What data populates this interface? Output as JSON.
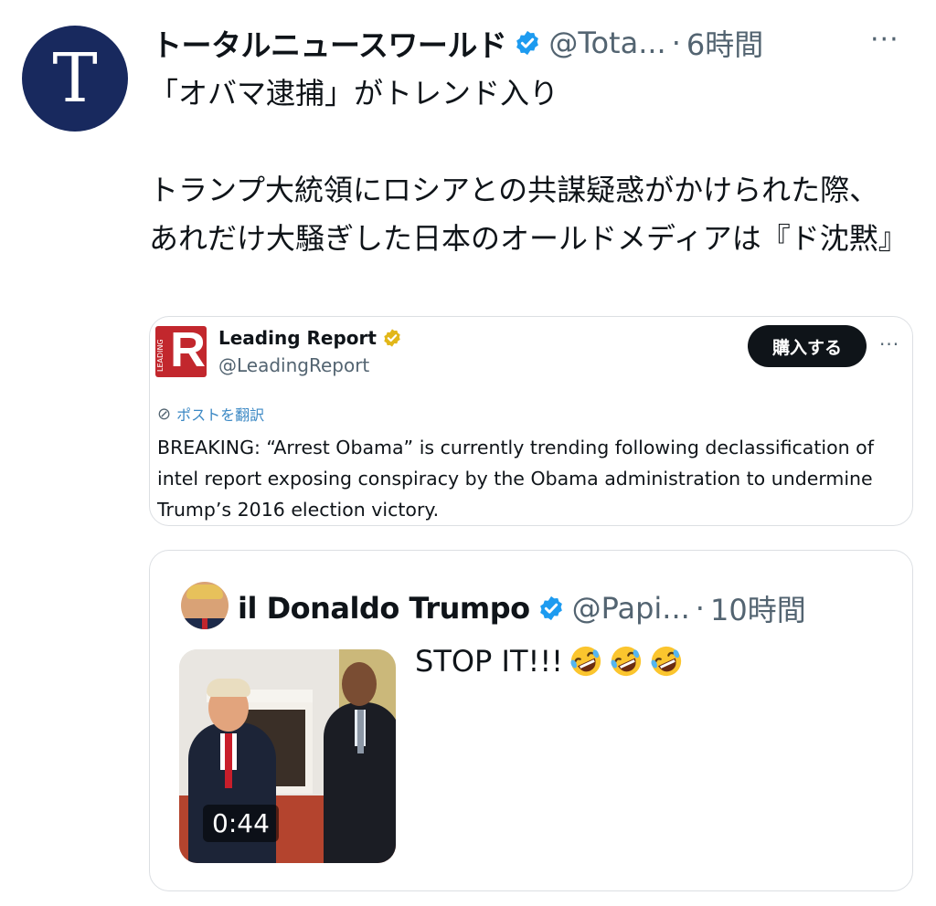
{
  "tweet": {
    "avatar_letter": "T",
    "author_name": "トータルニュースワールド",
    "handle": "@Tota...",
    "dot": "·",
    "time": "6時間",
    "more": "···",
    "text": "「オバマ逮捕」がトレンド入り\n\nトランプ大統領にロシアとの共謀疑惑がかけられた際、あれだけ大騒ぎした日本のオールドメディアは『ド沈黙』"
  },
  "embed": {
    "logo_letter": "R",
    "logo_side_text": "LEADING",
    "name": "Leading Report",
    "handle": "@LeadingReport",
    "buy_label": "購入する",
    "more": "···",
    "translate_label": "ポストを翻訳",
    "text": "BREAKING: “Arrest Obama” is currently trending following declassification of intel report exposing conspiracy by the Obama administration to undermine Trump’s 2016 election victory."
  },
  "quoted": {
    "name": "il Donaldo Trumpo",
    "handle": "@Papi...",
    "dot": "·",
    "time": "10時間",
    "text": "STOP IT!!!",
    "emoji_name": "rolling-on-the-floor-laughing",
    "video_duration": "0:44"
  },
  "colors": {
    "avatar_bg": "#18295e",
    "verified_blue": "#1d9bf0",
    "verified_gold": "#e2b719",
    "leading_red": "#c2272d",
    "secondary_text": "#536471",
    "link_blue": "#3b88c4"
  }
}
